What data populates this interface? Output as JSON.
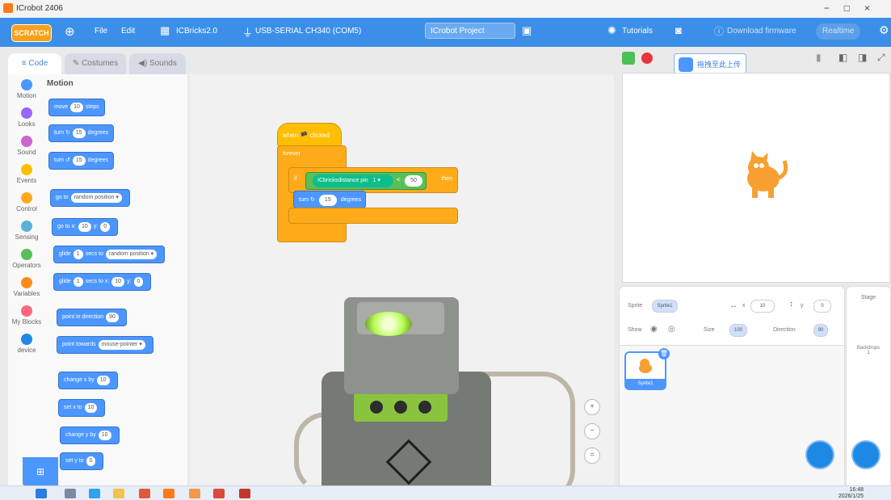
{
  "window": {
    "title": "ICrobot 2406"
  },
  "menubar": {
    "logo": "SCRATCH",
    "file": "File",
    "edit": "Edit",
    "extension": "ICBricks2.0",
    "connection": "USB-SERIAL CH340 (COM5)",
    "project_title": "ICrobot Project",
    "tutorials": "Tutorials",
    "download_firmware": "Download firmware",
    "mode": "Realtime"
  },
  "tabs": {
    "code": "Code",
    "costumes": "Costumes",
    "sounds": "Sounds"
  },
  "categories": [
    {
      "label": "Motion",
      "color": "#4c97ff"
    },
    {
      "label": "Looks",
      "color": "#9966ff"
    },
    {
      "label": "Sound",
      "color": "#cf63cf"
    },
    {
      "label": "Events",
      "color": "#ffbf00"
    },
    {
      "label": "Control",
      "color": "#ffab19"
    },
    {
      "label": "Sensing",
      "color": "#5cb1d6"
    },
    {
      "label": "Operators",
      "color": "#59c059"
    },
    {
      "label": "Variables",
      "color": "#ff8c1a"
    },
    {
      "label": "My Blocks",
      "color": "#ff6680"
    },
    {
      "label": "device",
      "color": "#1e88e5"
    }
  ],
  "palette": {
    "heading": "Motion",
    "blocks": [
      {
        "pre": "move",
        "v1": "10",
        "post": "steps"
      },
      {
        "pre": "turn ↻",
        "v1": "15",
        "post": "degrees"
      },
      {
        "pre": "turn ↺",
        "v1": "15",
        "post": "degrees"
      },
      {
        "pre": "go to",
        "v1": "random position ▾",
        "post": ""
      },
      {
        "pre": "go to x:",
        "v1": "10",
        "post": "y:",
        "v2": "0"
      },
      {
        "pre": "glide",
        "v1": "1",
        "post": "secs to",
        "v2": "random position ▾"
      },
      {
        "pre": "glide",
        "v1": "1",
        "post": "secs to x:",
        "v2": "10",
        "post2": "y:",
        "v3": "0"
      },
      {
        "pre": "point in direction",
        "v1": "90",
        "post": ""
      },
      {
        "pre": "point towards",
        "v1": "mouse-pointer ▾",
        "post": ""
      },
      {
        "pre": "change x by",
        "v1": "10",
        "post": ""
      },
      {
        "pre": "set x to",
        "v1": "10",
        "post": ""
      },
      {
        "pre": "change y by",
        "v1": "10",
        "post": ""
      },
      {
        "pre": "set y to",
        "v1": "0",
        "post": ""
      }
    ]
  },
  "script": {
    "hat": "when 🏴 clicked",
    "forever": "forever",
    "if": "if",
    "then": "then",
    "reporter": "ICbricksdistance pin",
    "pin": "1 ▾",
    "op": "<",
    "compare": "50",
    "turn": "turn ↻",
    "turn_value": "15",
    "turn_unit": "degrees"
  },
  "zoom": {
    "in": "+",
    "out": "−",
    "reset": "="
  },
  "stage": {
    "upload_label": "拖拽至此上传"
  },
  "sprite_panel": {
    "sprite_label": "Sprite",
    "sprite_name": "Sprite1",
    "x_label": "x",
    "x_value": "10",
    "y_label": "y",
    "y_value": "0",
    "show_label": "Show",
    "size_label": "Size",
    "size_value": "100",
    "direction_label": "Direction",
    "direction_value": "90",
    "thumb_name": "Sprite1"
  },
  "stage_panel": {
    "label": "Stage",
    "backdrops_label": "Backdrops",
    "backdrops_count": "1"
  },
  "taskbar": {
    "time": "16:48",
    "date": "2026/1/25"
  }
}
